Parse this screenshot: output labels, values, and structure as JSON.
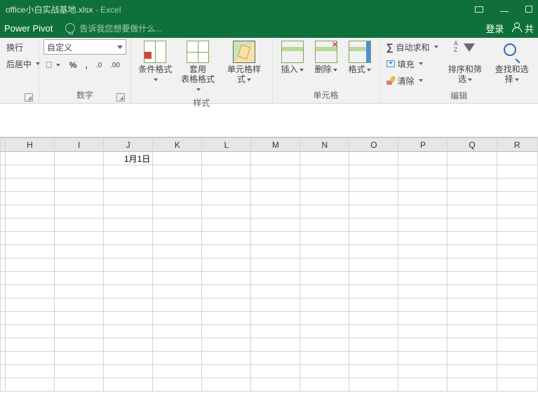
{
  "titlebar": {
    "filename": "office小白实战基地.xlsx",
    "app": "Excel"
  },
  "tabbar": {
    "tab_powerpivot": "Power Pivot",
    "tellme_placeholder": "告诉我您想要做什么...",
    "login": "登录",
    "share": "共"
  },
  "ribbon": {
    "align": {
      "wrap": "换行",
      "merge": "后居中"
    },
    "number": {
      "combo": "自定义",
      "label": "数字",
      "pct": "%",
      "comma": ","
    },
    "styles": {
      "cond": "条件格式",
      "table": "套用\n表格格式",
      "cell": "单元格样式",
      "label": "样式"
    },
    "cells": {
      "insert": "插入",
      "delete": "删除",
      "format": "格式",
      "label": "单元格"
    },
    "editing": {
      "sum": "自动求和",
      "fill": "填充",
      "clear": "清除",
      "sort": "排序和筛选",
      "find": "查找和选择",
      "label": "编辑"
    }
  },
  "sheet": {
    "columns": [
      "H",
      "I",
      "J",
      "K",
      "L",
      "M",
      "N",
      "O",
      "P",
      "Q",
      "R"
    ],
    "cells": {
      "J1": "1月1日"
    },
    "row_count": 18
  }
}
